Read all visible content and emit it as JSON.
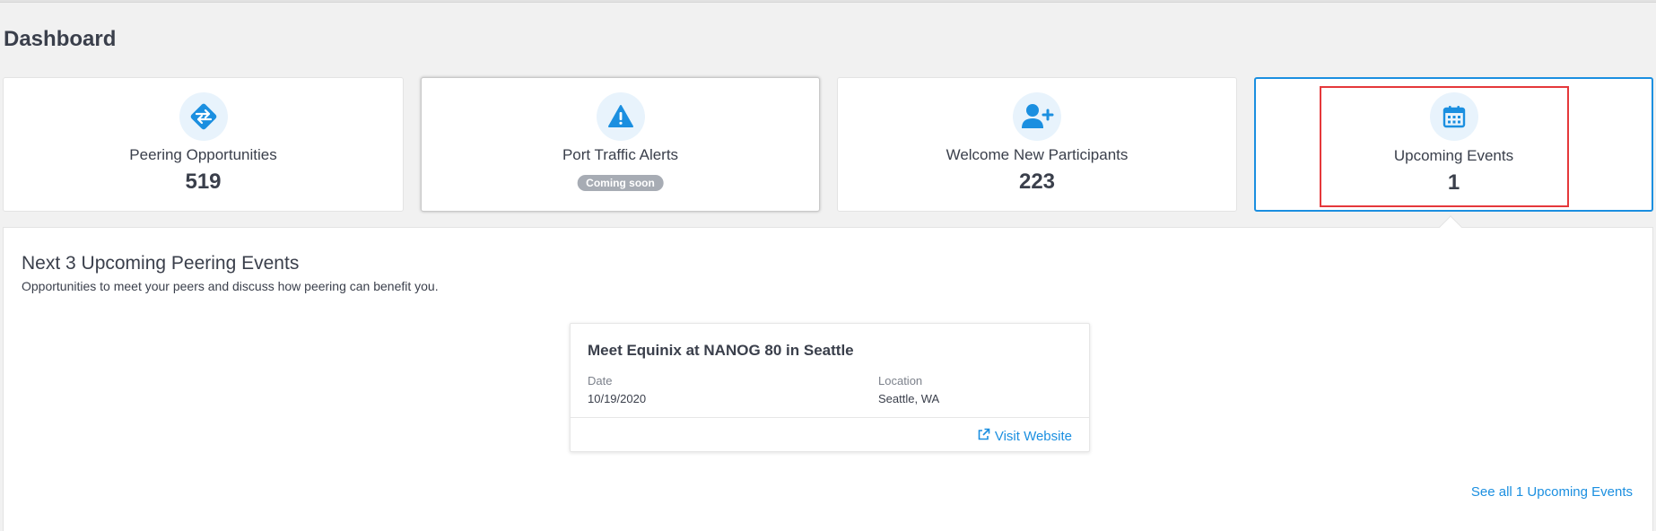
{
  "page": {
    "title": "Dashboard"
  },
  "cards": [
    {
      "label": "Peering Opportunities",
      "value": "519",
      "icon": "swap-arrows-icon"
    },
    {
      "label": "Port Traffic Alerts",
      "badge": "Coming soon",
      "icon": "warning-icon"
    },
    {
      "label": "Welcome New Participants",
      "value": "223",
      "icon": "add-user-icon"
    },
    {
      "label": "Upcoming Events",
      "value": "1",
      "icon": "calendar-icon"
    }
  ],
  "panel": {
    "title": "Next 3 Upcoming Peering Events",
    "subtitle": "Opportunities to meet your peers and discuss how peering can benefit you.",
    "events": [
      {
        "title": "Meet Equinix at NANOG 80 in Seattle",
        "date_label": "Date",
        "date": "10/19/2020",
        "location_label": "Location",
        "location": "Seattle, WA",
        "link_label": "Visit Website"
      }
    ],
    "see_all_label": "See all 1 Upcoming Events"
  },
  "colors": {
    "accent": "#1b8fe0",
    "highlight": "#e5383b",
    "badge": "#a7acb4"
  }
}
